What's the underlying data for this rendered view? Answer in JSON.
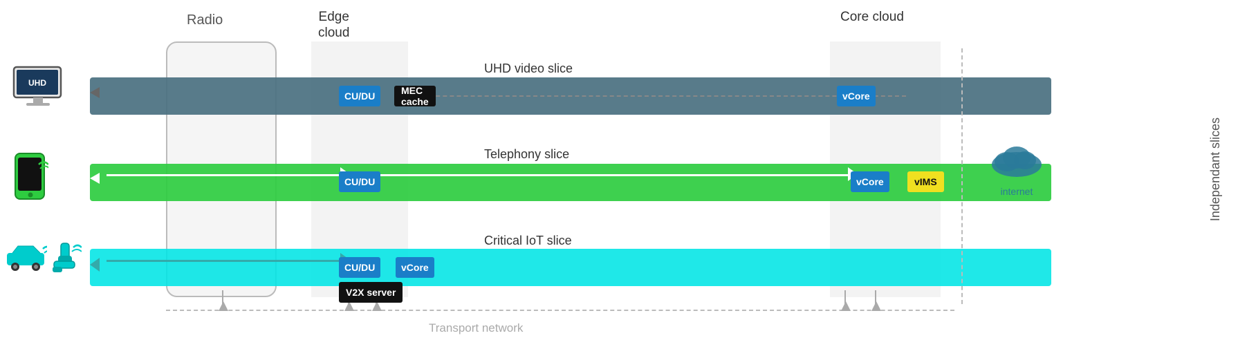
{
  "zones": {
    "radio_label": "Radio",
    "edge_label": "Edge\ncloud",
    "core_label": "Core\ncloud"
  },
  "slices": [
    {
      "id": "uhd",
      "label": "UHD video slice",
      "color": "#4a7080",
      "components": [
        "CU/DU",
        "MEC cache",
        "vCore"
      ]
    },
    {
      "id": "telephony",
      "label": "Telephony slice",
      "color": "#2ecc40",
      "components": [
        "CU/DU",
        "vCore",
        "vIMS"
      ]
    },
    {
      "id": "iot",
      "label": "Critical IoT slice",
      "color": "#00e5e5",
      "components": [
        "CU/DU",
        "vCore",
        "V2X server"
      ]
    }
  ],
  "transport": {
    "label": "Transport network"
  },
  "side_label": "Independant slices",
  "internet_label": "internet",
  "devices": {
    "uhd_screen": "UHD",
    "phone": "📱",
    "car": "🚗",
    "robot": "🦾"
  }
}
